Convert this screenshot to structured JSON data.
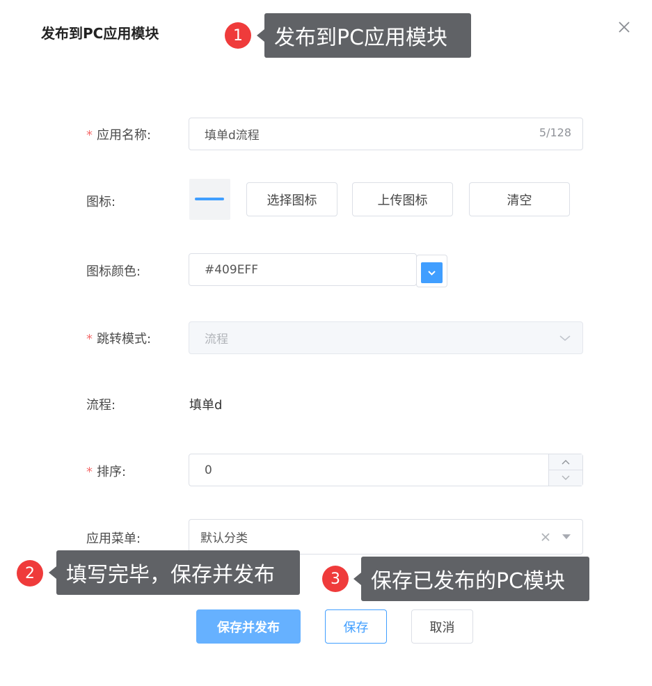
{
  "dialog": {
    "title": "发布到PC应用模块",
    "close_icon": "close-icon"
  },
  "form": {
    "required_mark": "*",
    "app_name": {
      "label": "应用名称:",
      "value": "填单d流程",
      "counter": "5/128"
    },
    "icon": {
      "label": "图标:",
      "preview_icon": "minus-icon",
      "select_button": "选择图标",
      "upload_button": "上传图标",
      "clear_button": "清空"
    },
    "icon_color": {
      "label": "图标颜色:",
      "value": "#409EFF",
      "swatch_color": "#409EFF"
    },
    "jump_mode": {
      "label": "跳转模式:",
      "value": "流程",
      "disabled": true
    },
    "flow": {
      "label": "流程:",
      "value": "填单d"
    },
    "sort": {
      "label": "排序:",
      "value": "0"
    },
    "app_menu": {
      "label": "应用菜单:",
      "value": "默认分类"
    }
  },
  "footer": {
    "save_publish_button": "保存并发布",
    "save_button": "保存",
    "cancel_button": "取消"
  },
  "annotations": [
    {
      "number": "1",
      "text": "发布到PC应用模块"
    },
    {
      "number": "2",
      "text": "填写完毕，保存并发布"
    },
    {
      "number": "3",
      "text": "保存已发布的PC模块"
    }
  ],
  "colors": {
    "primary": "#409EFF",
    "primary_light": "#66B1FF",
    "required": "#F56C6C",
    "annotation_badge": "#EF3B3B",
    "tooltip_bg": "#606266"
  }
}
